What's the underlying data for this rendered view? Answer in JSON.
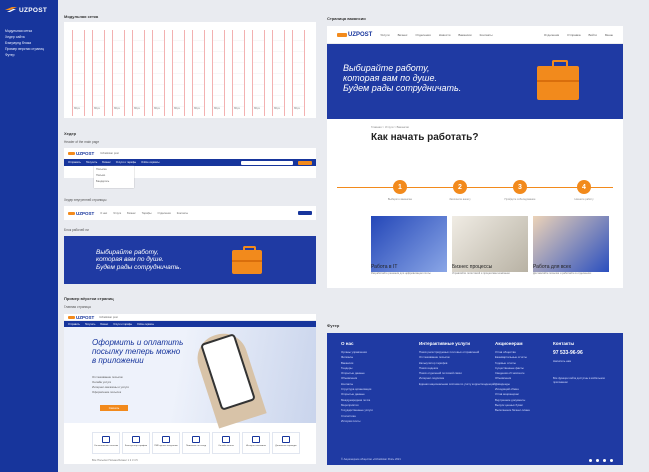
{
  "brand": {
    "logo": "UZPOST"
  },
  "sidebar": {
    "items": [
      {
        "label": "Модульная сетка"
      },
      {
        "label": "Хедер сайта"
      },
      {
        "label": "Бэкграунд блока"
      },
      {
        "label": "Пример верстки страниц"
      },
      {
        "label": "Футер"
      }
    ]
  },
  "sections": {
    "grid": "Модульная сетка",
    "header": "Хедер",
    "header_main": "Header of the main page",
    "header_inner": "Хедер внутренней страницы",
    "bg": "Блок рабочей ли",
    "layout": "Пример вёрстки страниц",
    "layout_sub": "Главная страница",
    "vacancy": "Страница вакансии",
    "footer": "Футер"
  },
  "grid_cols": [
    "80px",
    "80px",
    "80px",
    "80px",
    "80px",
    "80px",
    "80px",
    "80px",
    "80px",
    "80px",
    "80px",
    "80px"
  ],
  "header_nav": [
    "Отправить",
    "Получить",
    "Бизнес",
    "Услуги и тарифы",
    "Online сервисы"
  ],
  "header_top": [
    "Uzbekistan post",
    "Поиск по сайту..."
  ],
  "dropdown": {
    "item1": "Посылка",
    "item2": "Письмо",
    "item3": "Бандероль"
  },
  "inner_nav": [
    "О нас",
    "Услуги",
    "Бизнес",
    "Тарифы",
    "Отделения",
    "Контакты"
  ],
  "promo": {
    "line1": "Выбирайте работу,",
    "line2": "которая вам по душе.",
    "line3": "Будем рады сотрудничать."
  },
  "app": {
    "title1": "Оформить и оплатить",
    "title2": "посылку теперь можно",
    "title3": "в приложении",
    "bullets": [
      "Отслеживание посылок",
      "Онлайн услуги",
      "Интернет-магазины и услуги",
      "Оформление посылок"
    ],
    "btn": "Скачать",
    "tiles": [
      "Отслеживание посылки",
      "Калькулятор тарифов",
      "ПИК пункты получения",
      "Позвонить на склад",
      "Онлайн-оплата",
      "Интернет магазины",
      "Денежные переводы"
    ],
    "footer_links": "Все  Посылки  Письма  Бизнес  1 2 3 4 5"
  },
  "vacancy": {
    "nav": [
      "Услуги",
      "Бизнес",
      "Отделения",
      "Новости",
      "Вакансии",
      "Контакты"
    ],
    "nav_right": [
      "Отделения",
      "Отправка",
      "Войти",
      "Меню"
    ],
    "crumb": "Главная > Услуги > Вакансии",
    "heading": "Как начать работать?",
    "steps": [
      "1",
      "2",
      "3",
      "4"
    ],
    "step_labels": [
      "Выберите вакансию",
      "Заполните анкету",
      "Пройдите собеседование",
      "Начните работу"
    ],
    "cards": [
      {
        "title": "Работа в IT",
        "desc": "Разработайте решения для цифровизации почты"
      },
      {
        "title": "Бизнес процессы",
        "desc": "Управляйте логистикой и процессами компании"
      },
      {
        "title": "Работа для всех",
        "desc": "Доставляйте посылки и работайте в отделениях"
      }
    ]
  },
  "footer": {
    "col1_title": "О нас",
    "col1": [
      "Органы управления",
      "Филиалы",
      "Вакансии",
      "Тендеры",
      "Открытые данные",
      "Объявления",
      "Контакты",
      "Структура организации",
      "Открытые данные",
      "Международная почта",
      "Мероприятия",
      "Государственные услуги",
      "Статистика",
      "История почты"
    ],
    "col2_title": "Интерактивные услуги",
    "col2": [
      "Поиск регистрируемых почтовых отправлений",
      "Отслеживание посылок",
      "Калькулятор тарифов",
      "Поиск индекса",
      "Поиск отделений почтовой связи",
      "Интернет-подписка",
      "Единая национальная система по учёту корреспонденций"
    ],
    "col3_title": "Акционерам",
    "col3": [
      "Устав общества",
      "Ежеквартальные отчёты",
      "Годовые отчёты",
      "Существенные факты",
      "Сведения об эмитенте",
      "Объявления",
      "Дивиденды",
      "Исходящий обмен",
      "Устав акционерам",
      "Внутренние документы",
      "Выпуск ценных бумаг",
      "Выполнение бизнес-плана"
    ],
    "contact_title": "Контакты",
    "phone": "97 533-96-96",
    "email_label": "Написать нам",
    "app_label": "Все функции сайта доступны в мобильном приложении",
    "copyright": "© Акционерное общество «Uzbekistan Post» 2021"
  },
  "colors": {
    "blue": "#1f3aa3",
    "orange": "#f28a1c"
  }
}
